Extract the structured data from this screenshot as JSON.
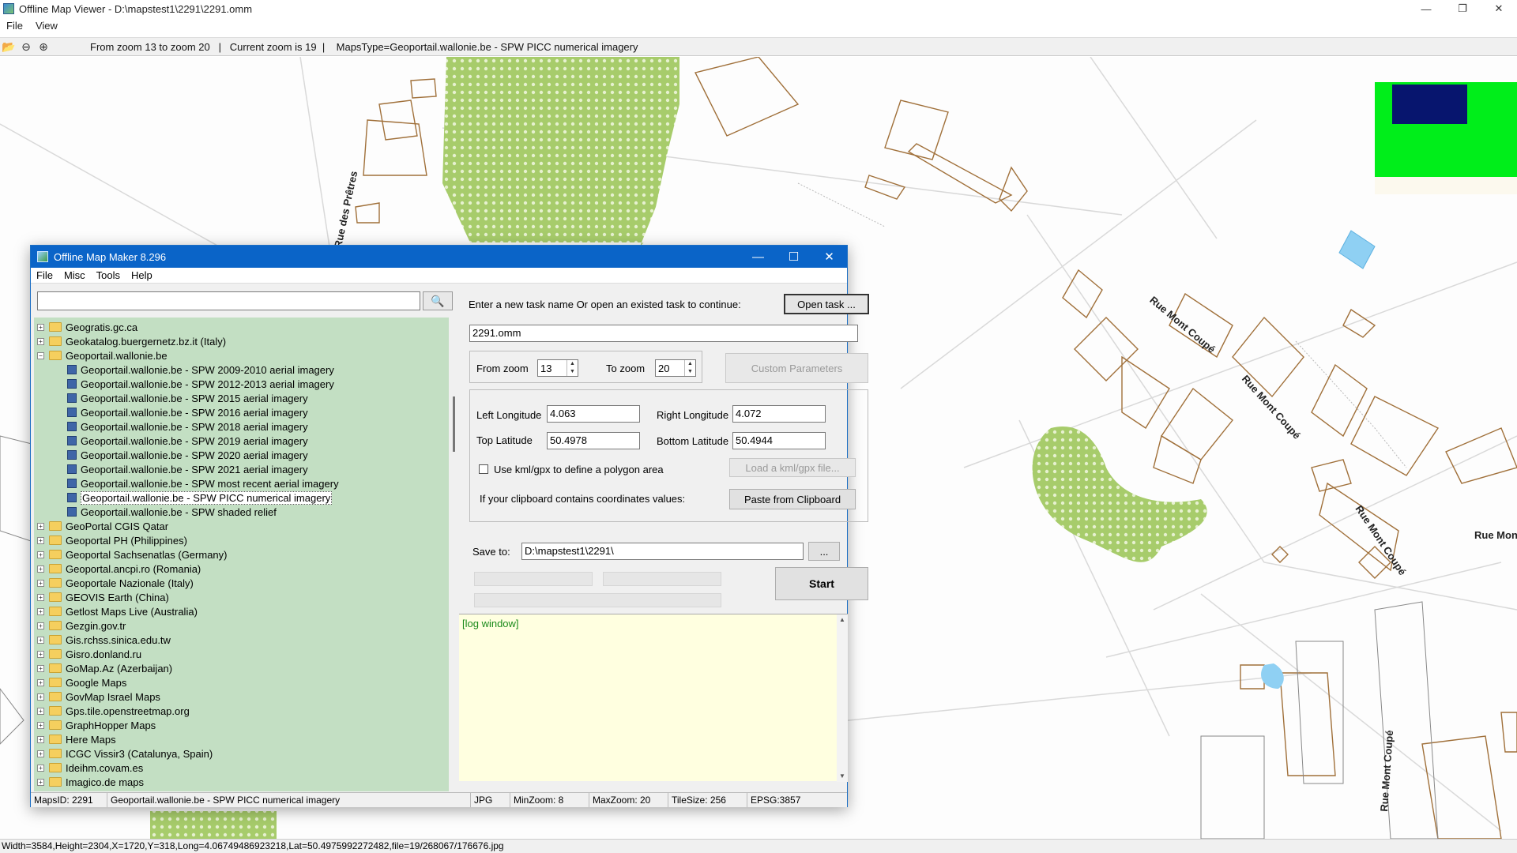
{
  "viewer": {
    "title": "Offline Map Viewer - D:\\mapstest1\\2291\\2291.omm",
    "menu": [
      "File",
      "View"
    ],
    "toolbar_info": "From zoom 13 to zoom 20   |   Current zoom is 19  |    MapsType=Geoportail.wallonie.be - SPW PICC numerical imagery",
    "status": "Width=3584,Height=2304,X=1720,Y=318,Long=4.06749486923218,Lat=50.4975992272482,file=19/268067/176676.jpg",
    "street_labels": [
      "Rue des Prêtres",
      "Rue Mont Coupé",
      "Rue Mont Coupé",
      "Rue Mont Coupé",
      "Rue Mon",
      "Rue Mont Coupé"
    ],
    "colors": {
      "vegetation": "#a7cc6b",
      "building_outline": "#a0703a",
      "water": "#8fd0f3",
      "marker_blue": "#07156e",
      "marker_green": "#00ee1a"
    }
  },
  "dialog": {
    "title": "Offline Map Maker 8.296",
    "menu": [
      "File",
      "Misc",
      "Tools",
      "Help"
    ],
    "search": {
      "value": "",
      "icon": "search-icon"
    },
    "tree": [
      {
        "label": "Geogratis.gc.ca",
        "type": "folder",
        "expanded": false,
        "level": 0
      },
      {
        "label": "Geokatalog.buergernetz.bz.it (Italy)",
        "type": "folder",
        "expanded": false,
        "level": 0
      },
      {
        "label": "Geoportail.wallonie.be",
        "type": "folder",
        "expanded": true,
        "level": 0
      },
      {
        "label": "Geoportail.wallonie.be - SPW 2009-2010 aerial imagery",
        "type": "map",
        "level": 1
      },
      {
        "label": "Geoportail.wallonie.be - SPW 2012-2013 aerial imagery",
        "type": "map",
        "level": 1
      },
      {
        "label": "Geoportail.wallonie.be - SPW 2015 aerial imagery",
        "type": "map",
        "level": 1
      },
      {
        "label": "Geoportail.wallonie.be - SPW 2016 aerial imagery",
        "type": "map",
        "level": 1
      },
      {
        "label": "Geoportail.wallonie.be - SPW 2018 aerial imagery",
        "type": "map",
        "level": 1
      },
      {
        "label": "Geoportail.wallonie.be - SPW 2019 aerial imagery",
        "type": "map",
        "level": 1
      },
      {
        "label": "Geoportail.wallonie.be - SPW 2020 aerial imagery",
        "type": "map",
        "level": 1
      },
      {
        "label": "Geoportail.wallonie.be - SPW 2021 aerial imagery",
        "type": "map",
        "level": 1
      },
      {
        "label": "Geoportail.wallonie.be - SPW most recent aerial imagery",
        "type": "map",
        "level": 1
      },
      {
        "label": "Geoportail.wallonie.be - SPW PICC numerical imagery",
        "type": "map",
        "level": 1,
        "selected": true
      },
      {
        "label": "Geoportail.wallonie.be - SPW shaded relief",
        "type": "map",
        "level": 1
      },
      {
        "label": "GeoPortal CGIS Qatar",
        "type": "folder",
        "expanded": false,
        "level": 0
      },
      {
        "label": "Geoportal PH (Philippines)",
        "type": "folder",
        "expanded": false,
        "level": 0
      },
      {
        "label": "Geoportal Sachsenatlas (Germany)",
        "type": "folder",
        "expanded": false,
        "level": 0
      },
      {
        "label": "Geoportal.ancpi.ro (Romania)",
        "type": "folder",
        "expanded": false,
        "level": 0
      },
      {
        "label": "Geoportale Nazionale (Italy)",
        "type": "folder",
        "expanded": false,
        "level": 0
      },
      {
        "label": "GEOVIS Earth (China)",
        "type": "folder",
        "expanded": false,
        "level": 0
      },
      {
        "label": "Getlost Maps Live (Australia)",
        "type": "folder",
        "expanded": false,
        "level": 0
      },
      {
        "label": "Gezgin.gov.tr",
        "type": "folder",
        "expanded": false,
        "level": 0
      },
      {
        "label": "Gis.rchss.sinica.edu.tw",
        "type": "folder",
        "expanded": false,
        "level": 0
      },
      {
        "label": "Gisro.donland.ru",
        "type": "folder",
        "expanded": false,
        "level": 0
      },
      {
        "label": "GoMap.Az (Azerbaijan)",
        "type": "folder",
        "expanded": false,
        "level": 0
      },
      {
        "label": "Google Maps",
        "type": "folder",
        "expanded": false,
        "level": 0
      },
      {
        "label": "GovMap Israel Maps",
        "type": "folder",
        "expanded": false,
        "level": 0
      },
      {
        "label": "Gps.tile.openstreetmap.org",
        "type": "folder",
        "expanded": false,
        "level": 0
      },
      {
        "label": "GraphHopper Maps",
        "type": "folder",
        "expanded": false,
        "level": 0
      },
      {
        "label": "Here Maps",
        "type": "folder",
        "expanded": false,
        "level": 0
      },
      {
        "label": "ICGC Vissir3 (Catalunya, Spain)",
        "type": "folder",
        "expanded": false,
        "level": 0
      },
      {
        "label": "Ideihm.covam.es",
        "type": "folder",
        "expanded": false,
        "level": 0
      },
      {
        "label": "Imagico.de maps",
        "type": "folder",
        "expanded": false,
        "level": 0
      }
    ],
    "task_prompt": "Enter a new task name Or open an existed task to continue:",
    "open_task_label": "Open task ...",
    "task_name": "2291.omm",
    "from_zoom_label": "From zoom",
    "from_zoom": "13",
    "to_zoom_label": "To zoom",
    "to_zoom": "20",
    "custom_params_label": "Custom Parameters",
    "left_lon_label": "Left Longitude",
    "left_lon": "4.063",
    "right_lon_label": "Right Longitude",
    "right_lon": "4.072",
    "top_lat_label": "Top Latitude",
    "top_lat": "50.4978",
    "bottom_lat_label": "Bottom Latitude",
    "bottom_lat": "50.4944",
    "kml_label": "Use kml/gpx to define a polygon area",
    "kml_checked": false,
    "load_kml_label": "Load a kml/gpx file...",
    "clipboard_label": "If your clipboard contains coordinates values:",
    "paste_label": "Paste from Clipboard",
    "save_to_label": "Save to:",
    "save_to": "D:\\mapstest1\\2291\\",
    "browse_label": "...",
    "start_label": "Start",
    "progress": [
      0,
      0,
      0
    ],
    "log_text": "[log window]",
    "status": {
      "maps_id": "MapsID: 2291",
      "map_name": "Geoportail.wallonie.be - SPW PICC numerical imagery",
      "format": "JPG",
      "min_zoom": "MinZoom: 8",
      "max_zoom": "MaxZoom: 20",
      "tile_size": "TileSize: 256",
      "epsg": "EPSG:3857"
    }
  }
}
